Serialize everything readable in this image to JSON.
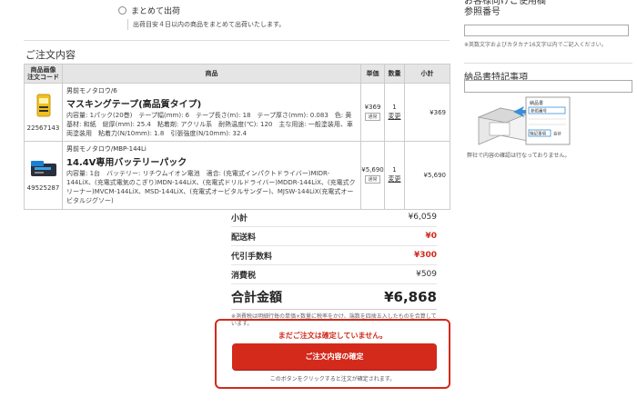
{
  "shipping": {
    "option_label": "まとめて出荷",
    "option_note": "出荷目安４日以内の商品をまとめて出荷いたします。"
  },
  "order": {
    "section_title": "ご注文内容",
    "headers": {
      "image": "商品画像\n注文コード",
      "product": "商品",
      "unit_price": "単価",
      "qty": "数量",
      "subtotal": "小計"
    },
    "items": [
      {
        "code": "22567143",
        "maker": "男前モノタロウ/6",
        "name": "マスキングテープ(高品質タイプ)",
        "desc": "内容量: 1パック(20巻)　テープ幅(mm): 6　テープ長さ(m): 18　テープ厚さ(mm): 0.083　色: 黄　基材: 和紙　総厚(mm): 25.4　粘着剤: アクリル系　耐熱温度(℃): 120　主な用途: 一般塗装用、車両塗装用　粘着力(N/10mm): 1.8　引張強度(N/10mm): 32.4",
        "unit_price": "¥369",
        "badge": "通常",
        "qty": "1",
        "change": "変更",
        "subtotal": "¥369",
        "icon": "masking-tape-icon"
      },
      {
        "code": "49525287",
        "maker": "男前モノタロウ/MBP-144Li",
        "name": "14.4V専用バッテリーパック",
        "desc": "内容量: 1台　バッテリー: リチウムイオン電池　適合: (充電式インパクトドライバー)MIDR-144LiX、(充電式電気のこぎり)MDN-144LiX、(充電式ドリルドライバー)MDDR-144LiX、(充電式クリーナー)MVCM-144LiX、MSD-144LiX、(充電式オービタルサンダー)、MJSW-144LiX(充電式オービタルジグソー)",
        "unit_price": "¥5,690",
        "badge": "通常",
        "qty": "1",
        "change": "変更",
        "subtotal": "¥5,690",
        "icon": "battery-pack-icon"
      }
    ]
  },
  "summary": {
    "subtotal_label": "小計",
    "subtotal": "¥6,059",
    "shipping_label": "配送料",
    "shipping": "¥0",
    "cod_label": "代引手数料",
    "cod": "¥300",
    "tax_label": "消費税",
    "tax": "¥509",
    "total_label": "合計金額",
    "total": "¥6,868",
    "tax_note": "※消費税は明細行毎の単価×数量に税率をかけ、端数を四捨五入したものを合算しています。"
  },
  "confirm": {
    "warning": "まだご注文は確定していません。",
    "button": "ご注文内容の確定",
    "sub": "このボタンをクリックすると注文が確定されます。"
  },
  "sidebar": {
    "ref_heading": "お客様向けご使用欄\n参照番号",
    "ref_note": "※英数文字およびカタカナ16文字以内でご記入ください。",
    "notes_title": "納品書特記事項",
    "notes_caption": "弊社で内容の確認は行なっておりません。",
    "illus_labels": [
      "納品書",
      "参照番号",
      "特記事項",
      "合計"
    ]
  },
  "colors": {
    "accent_red": "#d32a1c",
    "header_gray": "#e5e5e5"
  }
}
